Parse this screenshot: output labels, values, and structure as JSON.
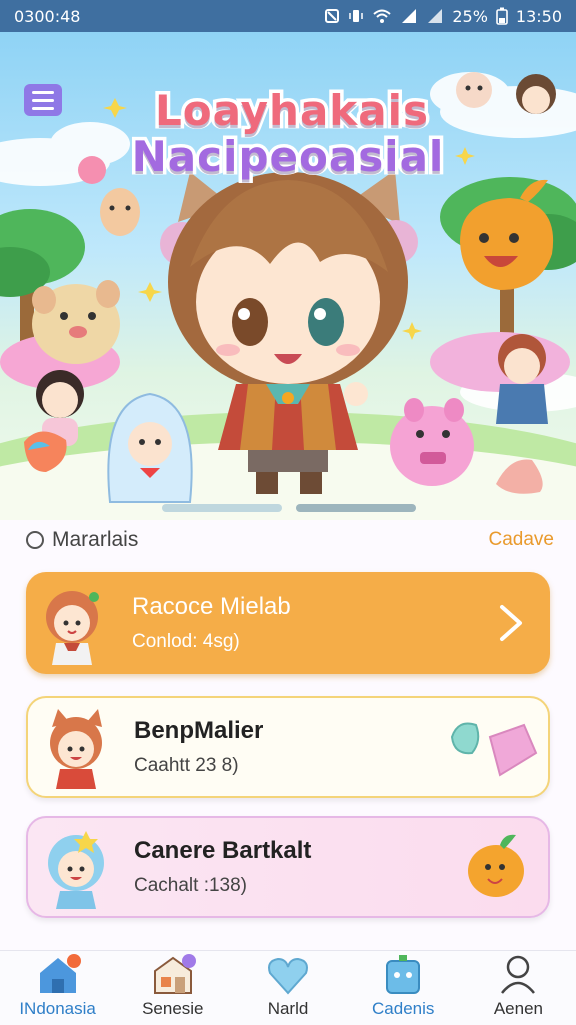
{
  "status_bar": {
    "time_left": "0300:48",
    "battery": "25%",
    "time_right": "13:50"
  },
  "hero": {
    "title_line1": "Loayhakais",
    "title_line2": "Nacipeoasial"
  },
  "section": {
    "title": "Mararlais",
    "link": "Cadave"
  },
  "cards": [
    {
      "name": "Racoce Mielab",
      "sub": "Conlod: 4sg)"
    },
    {
      "name": "BenpMalier",
      "sub": "Caahtt 23 8)"
    },
    {
      "name": "Canere Bartkalt",
      "sub": "Cachalt :138)"
    }
  ],
  "bottom_nav": [
    {
      "label": "INdonasia",
      "icon": "home-icon"
    },
    {
      "label": "Senesie",
      "icon": "shop-icon"
    },
    {
      "label": "Narld",
      "icon": "heart-icon"
    },
    {
      "label": "Cadenis",
      "icon": "game-icon"
    },
    {
      "label": "Aenen",
      "icon": "profile-icon"
    }
  ],
  "colors": {
    "accent": "#f5ad48",
    "nav_active": "#2f7fc8",
    "menu": "#8f78e6",
    "status_bar": "#3f6fa0"
  }
}
